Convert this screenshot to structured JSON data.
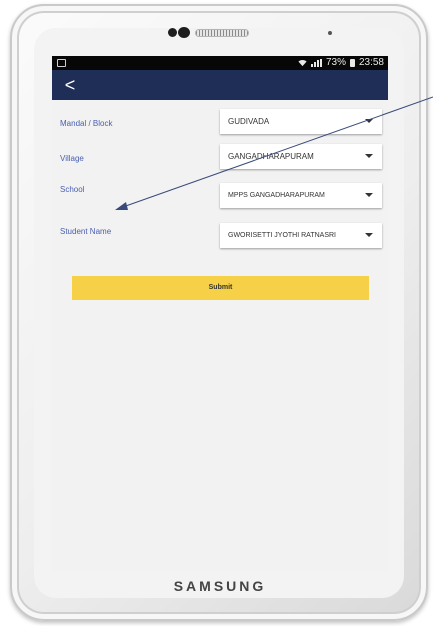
{
  "device": {
    "brand": "SAMSUNG"
  },
  "status_bar": {
    "battery_percent": "73%",
    "time": "23:58"
  },
  "app_bar": {
    "back_icon": "back-arrow-icon",
    "back_glyph": "<"
  },
  "form": {
    "fields": [
      {
        "label": "Mandal / Block",
        "value": "GUDIVADA"
      },
      {
        "label": "Village",
        "value": "GANGADHARAPURAM"
      },
      {
        "label": "School",
        "value": "MPPS GANGADHARAPURAM"
      },
      {
        "label": "Student Name",
        "value": "GWORISETTI JYOTHI RATNASRI"
      }
    ],
    "submit_label": "Submit"
  },
  "colors": {
    "app_bar": "#1f2e57",
    "label_text": "#4a60b0",
    "submit_button": "#f6d046",
    "status_bar": "#070707"
  }
}
